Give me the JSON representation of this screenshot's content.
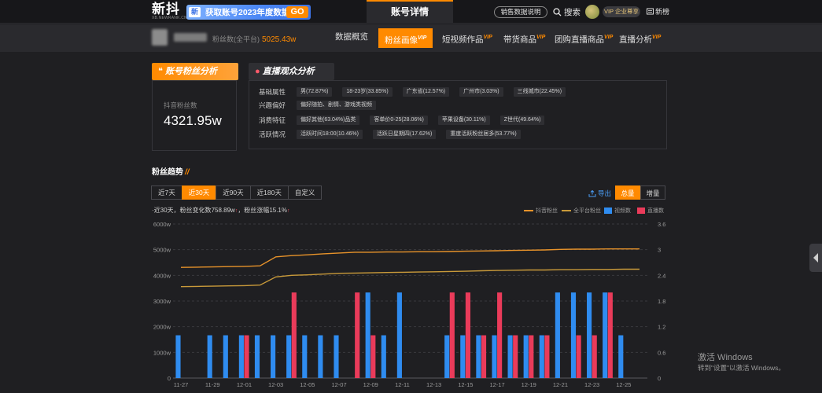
{
  "header": {
    "logo_text": "新抖",
    "logo_sub": "XB.NEWRANK.CN",
    "promo_badge": "新",
    "promo_text": "获取账号2023年度数据",
    "promo_go": "GO",
    "center_title": "账号详情",
    "sales_btn": "销售数据说明",
    "search_label": "搜索",
    "vip_badge": "VIP 企业尊享",
    "news_label": "新榜"
  },
  "account": {
    "fans_total_label": "粉丝数(全平台)",
    "fans_total_value": "5025.43w",
    "tabs": [
      {
        "label": "数据概览",
        "vip": ""
      },
      {
        "label": "粉丝画像",
        "vip": "VIP"
      },
      {
        "label": "短视频作品",
        "vip": "VIP"
      },
      {
        "label": "带货商品",
        "vip": "VIP"
      },
      {
        "label": "团购直播商品",
        "vip": "VIP"
      },
      {
        "label": "直播分析",
        "vip": "VIP"
      }
    ]
  },
  "fan_panel": {
    "tag": "账号粉丝分析",
    "label": "抖音粉丝数",
    "value": "4321.95w"
  },
  "live_panel": {
    "tag": "直播观众分析",
    "rows": [
      {
        "label": "基础属性",
        "chips": [
          "男(72.87%)",
          "18-23岁(33.85%)",
          "广东省(12.57%)",
          "广州市(3.03%)",
          "三线城市(22.45%)"
        ]
      },
      {
        "label": "兴趣偏好",
        "chips": [
          "偏好随拍、剧情、游戏类视频"
        ]
      },
      {
        "label": "消费特征",
        "chips": [
          "偏好其他(63.04%)品类",
          "客单价0-25(28.06%)",
          "苹果设备(30.11%)",
          "Z世代(49.64%)"
        ]
      },
      {
        "label": "活跃情况",
        "chips": [
          "活跃时间18:00(10.46%)",
          "活跃日星期四(17.62%)",
          "重度活跃粉丝居多(53.77%)"
        ]
      }
    ]
  },
  "trend": {
    "title": "粉丝趋势",
    "ranges": [
      "近7天",
      "近30天",
      "近90天",
      "近180天",
      "自定义"
    ],
    "active_range": "近30天",
    "export_label": "导出",
    "seg_total": "总量",
    "seg_increase": "增量",
    "summary_prefix": "·近30天，粉丝变化数",
    "summary_change": "758.89w",
    "summary_mid": "，粉丝涨幅",
    "summary_rate": "15.1%",
    "legend": [
      {
        "name": "抖音粉丝",
        "kind": "line",
        "color": "#e8932a"
      },
      {
        "name": "全平台粉丝",
        "kind": "line",
        "color": "#c99a3a"
      },
      {
        "name": "视频数",
        "kind": "box",
        "color": "#2f8cf0"
      },
      {
        "name": "直播数",
        "kind": "box",
        "color": "#ea3b5a"
      }
    ]
  },
  "chart_data": {
    "type": "bar",
    "x": [
      "11-27",
      "11-28",
      "11-29",
      "11-30",
      "12-01",
      "12-02",
      "12-03",
      "12-04",
      "12-05",
      "12-06",
      "12-07",
      "12-08",
      "12-09",
      "12-10",
      "12-11",
      "12-12",
      "12-13",
      "12-14",
      "12-15",
      "12-16",
      "12-17",
      "12-18",
      "12-19",
      "12-20",
      "12-21",
      "12-22",
      "12-23",
      "12-24",
      "12-25",
      "12-26"
    ],
    "x_ticks": [
      "11-27",
      "11-29",
      "12-01",
      "12-03",
      "12-05",
      "12-07",
      "12-09",
      "12-11",
      "12-13",
      "12-15",
      "12-17",
      "12-19",
      "12-21",
      "12-23",
      "12-25"
    ],
    "y_left_ticks": [
      "0",
      "1000w",
      "2000w",
      "3000w",
      "4000w",
      "5000w",
      "6000w"
    ],
    "y_right_ticks": [
      "0",
      "0.6",
      "1.2",
      "1.8",
      "2.4",
      "3",
      "3.6"
    ],
    "ylim_left": [
      0,
      6000
    ],
    "ylim_right": [
      0,
      3.6
    ],
    "series": [
      {
        "name": "抖音粉丝",
        "type": "line",
        "axis": "left",
        "color": "#e8932a",
        "values": [
          4310,
          4320,
          4330,
          4340,
          4350,
          4370,
          4720,
          4770,
          4800,
          4840,
          4870,
          4900,
          4900,
          4910,
          4910,
          4920,
          4920,
          4930,
          4940,
          4950,
          4960,
          4970,
          4980,
          4990,
          5010,
          5020,
          5020,
          5030,
          5030,
          5030
        ]
      },
      {
        "name": "全平台粉丝",
        "type": "line",
        "axis": "left",
        "color": "#c99a3a",
        "values": [
          3560,
          3570,
          3580,
          3590,
          3600,
          3620,
          3940,
          4000,
          4020,
          4050,
          4080,
          4090,
          4100,
          4110,
          4120,
          4130,
          4140,
          4150,
          4160,
          4180,
          4190,
          4200,
          4210,
          4210,
          4220,
          4220,
          4230,
          4230,
          4240,
          4240
        ]
      },
      {
        "name": "视频数",
        "type": "bar",
        "axis": "right",
        "color": "#2f8cf0",
        "values": [
          1,
          0,
          1,
          1,
          1,
          1,
          1,
          1,
          1,
          1,
          1,
          0,
          2,
          1,
          2,
          0,
          0,
          1,
          1,
          1,
          1,
          1,
          1,
          1,
          2,
          2,
          2,
          2,
          1,
          0
        ]
      },
      {
        "name": "直播数",
        "type": "bar",
        "axis": "right",
        "color": "#ea3b5a",
        "values": [
          0,
          0,
          0,
          0,
          1,
          0,
          0,
          2,
          0,
          0,
          0,
          2,
          1,
          0,
          0,
          0,
          0,
          2,
          2,
          1,
          2,
          1,
          1,
          1,
          0,
          1,
          1,
          2,
          0,
          0
        ]
      }
    ]
  },
  "windows": {
    "line1": "激活 Windows",
    "line2": "转到\"设置\"以激活 Windows。"
  }
}
